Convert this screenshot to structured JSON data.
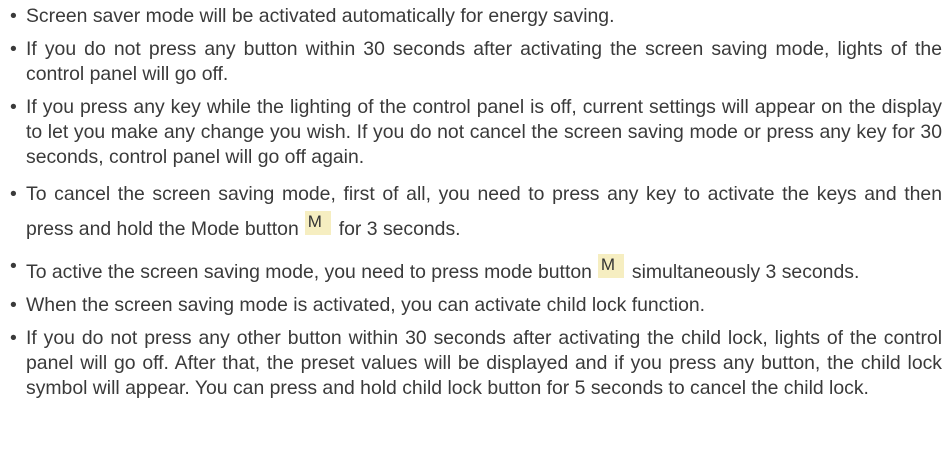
{
  "items": [
    {
      "text": "Screen saver mode will be activated automatically for energy saving."
    },
    {
      "text": "If you do not press any button within 30 seconds after activating the screen saving mode, lights of the control panel will go off."
    },
    {
      "text": "If you press any key while the lighting of the control panel is off, current settings will appear on the display to let you make any change you wish. If you do not cancel the screen saving mode or press any key for 30 seconds, control panel will go off again."
    },
    {
      "text_a": "To cancel the screen saving mode, first of all, you need to press any key to activate the keys and then press and hold the Mode button",
      "key": "M",
      "text_b": "for 3 seconds."
    },
    {
      "text_a": "To active the screen saving mode, you need to press mode button",
      "key": "M",
      "text_b": "simultaneously 3 seconds."
    },
    {
      "text": "When the screen saving mode is activated, you can activate child lock function."
    },
    {
      "text": "If you do not press any other button within 30 seconds after activating the child lock, lights of the control panel will go off. After that, the preset values will be displayed and if you press any button, the child lock symbol will appear. You can press and hold child lock button for 5 seconds to cancel the child lock."
    }
  ],
  "colors": {
    "text": "#3a3a3a",
    "key_background": "#f6eec1"
  }
}
